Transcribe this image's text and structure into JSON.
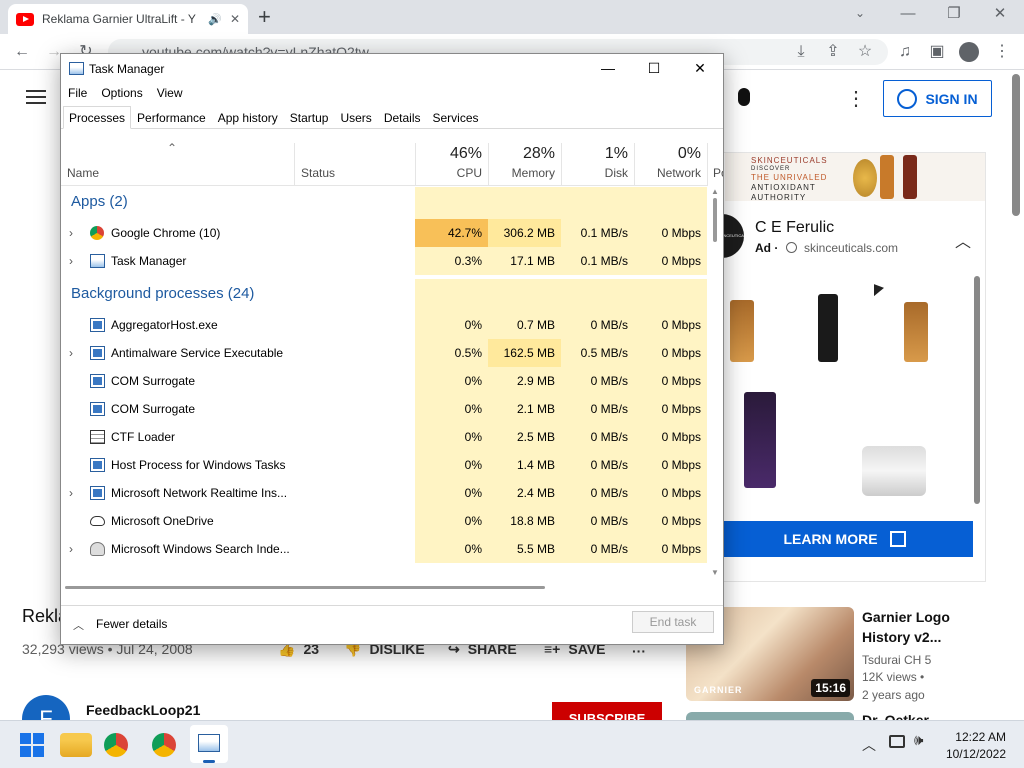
{
  "browser": {
    "tab_title": "Reklama Garnier UltraLift - Y",
    "url": "youtube.com/watch?v=yLnZhatO2tw",
    "new_tab": "+",
    "window_controls": {
      "minimize": "—",
      "restore": "❐",
      "close": "✕"
    },
    "tab_controls": {
      "mute": "🔊",
      "close": "✕"
    }
  },
  "youtube": {
    "signin_label": "SIGN IN",
    "video_title_fragment": "Rekla",
    "views_date": "32,293 views • Jul 24, 2008",
    "like_count": "23",
    "dislike_label": "DISLIKE",
    "share_label": "SHARE",
    "save_label": "SAVE",
    "more_label": "···",
    "channel_initial": "F",
    "channel_name": "FeedbackLoop21",
    "subscribe_label": "SUBSCRIBE",
    "ad": {
      "banner_brand": "SKINCEUTICALS",
      "banner_line1": "DISCOVER",
      "banner_line2": "THE UNRIVALED",
      "banner_line3": "ANTIOXIDANT",
      "banner_line4": "AUTHORITY",
      "title": "C E Ferulic",
      "ad_badge": "Ad ·",
      "domain": "skinceuticals.com",
      "cta": "LEARN MORE",
      "logo_text": "SKINCEUTICALS"
    },
    "recommended": {
      "title": "Garnier Logo History v2...",
      "channel": "Tsdurai CH 5",
      "views": "12K views •",
      "age": "2 years ago",
      "duration": "15:16",
      "thumb_brand": "GARNIER",
      "next_title_fragment": "Dr. Oetker"
    }
  },
  "task_manager": {
    "title": "Task Manager",
    "menu": [
      "File",
      "Options",
      "View"
    ],
    "tabs": [
      "Processes",
      "Performance",
      "App history",
      "Startup",
      "Users",
      "Details",
      "Services"
    ],
    "active_tab": "Processes",
    "sort_arrow": "⌃",
    "headers": {
      "name": "Name",
      "status": "Status",
      "cpu_pct": "46%",
      "cpu": "CPU",
      "mem_pct": "28%",
      "mem": "Memory",
      "disk_pct": "1%",
      "disk": "Disk",
      "net_pct": "0%",
      "net": "Network",
      "power": "Po"
    },
    "apps_group": "Apps (2)",
    "bg_group": "Background processes (24)",
    "apps": [
      {
        "name": "Google Chrome (10)",
        "cpu": "42.7%",
        "mem": "306.2 MB",
        "disk": "0.1 MB/s",
        "net": "0 Mbps",
        "expandable": true,
        "icon": "chrome-icon"
      },
      {
        "name": "Task Manager",
        "cpu": "0.3%",
        "mem": "17.1 MB",
        "disk": "0.1 MB/s",
        "net": "0 Mbps",
        "expandable": true,
        "icon": "task-manager-icon"
      }
    ],
    "background": [
      {
        "name": "AggregatorHost.exe",
        "cpu": "0%",
        "mem": "0.7 MB",
        "disk": "0 MB/s",
        "net": "0 Mbps",
        "expandable": false,
        "icon": "app-window-icon"
      },
      {
        "name": "Antimalware Service Executable",
        "cpu": "0.5%",
        "mem": "162.5 MB",
        "disk": "0.5 MB/s",
        "net": "0 Mbps",
        "expandable": true,
        "icon": "app-window-icon"
      },
      {
        "name": "COM Surrogate",
        "cpu": "0%",
        "mem": "2.9 MB",
        "disk": "0 MB/s",
        "net": "0 Mbps",
        "expandable": false,
        "icon": "app-window-icon"
      },
      {
        "name": "COM Surrogate",
        "cpu": "0%",
        "mem": "2.1 MB",
        "disk": "0 MB/s",
        "net": "0 Mbps",
        "expandable": false,
        "icon": "app-window-icon"
      },
      {
        "name": "CTF Loader",
        "cpu": "0%",
        "mem": "2.5 MB",
        "disk": "0 MB/s",
        "net": "0 Mbps",
        "expandable": false,
        "icon": "ctf-loader-icon"
      },
      {
        "name": "Host Process for Windows Tasks",
        "cpu": "0%",
        "mem": "1.4 MB",
        "disk": "0 MB/s",
        "net": "0 Mbps",
        "expandable": false,
        "icon": "app-window-icon"
      },
      {
        "name": "Microsoft Network Realtime Ins...",
        "cpu": "0%",
        "mem": "2.4 MB",
        "disk": "0 MB/s",
        "net": "0 Mbps",
        "expandable": true,
        "icon": "app-window-icon"
      },
      {
        "name": "Microsoft OneDrive",
        "cpu": "0%",
        "mem": "18.8 MB",
        "disk": "0 MB/s",
        "net": "0 Mbps",
        "expandable": false,
        "icon": "onedrive-icon"
      },
      {
        "name": "Microsoft Windows Search Inde...",
        "cpu": "0%",
        "mem": "5.5 MB",
        "disk": "0 MB/s",
        "net": "0 Mbps",
        "expandable": true,
        "icon": "search-indexer-icon"
      }
    ],
    "fewer_details": "Fewer details",
    "end_task": "End task",
    "window_controls": {
      "minimize": "—",
      "maximize": "☐",
      "close": "✕"
    }
  },
  "taskbar": {
    "time": "12:22 AM",
    "date": "10/12/2022"
  },
  "colors": {
    "cpu_hot": "#f8c058",
    "cell_light": "#fff4c4",
    "cell_mid": "#ffe99c",
    "group_blue": "#1e5aa0",
    "yt_blue": "#065fd4"
  }
}
